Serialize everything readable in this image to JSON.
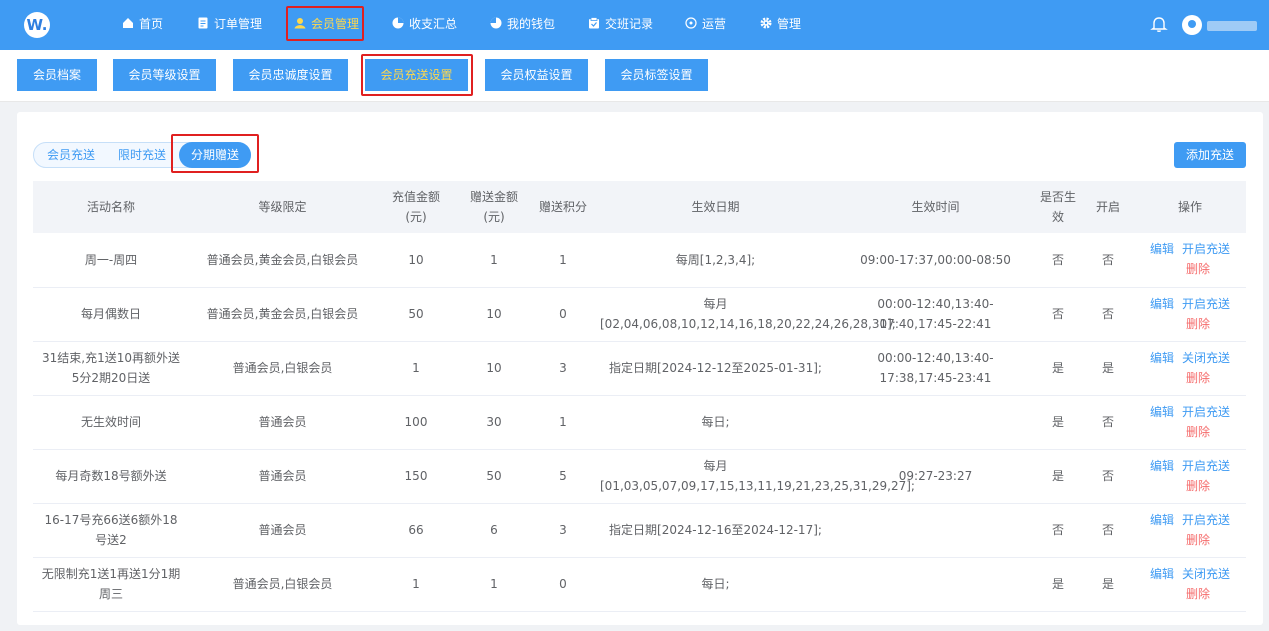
{
  "logo": "W.",
  "nav": [
    {
      "label": "首页",
      "icon": "home-icon"
    },
    {
      "label": "订单管理",
      "icon": "order-icon"
    },
    {
      "label": "会员管理",
      "icon": "member-icon"
    },
    {
      "label": "收支汇总",
      "icon": "pie-icon"
    },
    {
      "label": "我的钱包",
      "icon": "wallet-icon"
    },
    {
      "label": "交班记录",
      "icon": "shift-icon"
    },
    {
      "label": "运营",
      "icon": "compass-icon"
    },
    {
      "label": "管理",
      "icon": "gear-icon"
    }
  ],
  "subnav": [
    "会员档案",
    "会员等级设置",
    "会员忠诚度设置",
    "会员充送设置",
    "会员权益设置",
    "会员标签设置"
  ],
  "segments": [
    "会员充送",
    "限时充送",
    "分期赠送"
  ],
  "add_button": "添加充送",
  "table": {
    "headers": [
      "活动名称",
      "等级限定",
      "充值金额(元)",
      "赠送金额(元)",
      "赠送积分",
      "生效日期",
      "生效时间",
      "是否生效",
      "开启",
      "操作"
    ],
    "rows": [
      {
        "name": "周一-周四",
        "level": "普通会员,黄金会员,白银会员",
        "amount": "10",
        "gift": "1",
        "points": "1",
        "date": "每周[1,2,3,4];",
        "time": "09:00-17:37,00:00-08:50",
        "effective": "否",
        "open": "否",
        "edit": "编辑",
        "toggle": "开启充送",
        "del": "删除"
      },
      {
        "name": "每月偶数日",
        "level": "普通会员,黄金会员,白银会员",
        "amount": "50",
        "gift": "10",
        "points": "0",
        "date": "每月[02,04,06,08,10,12,14,16,18,20,22,24,26,28,30];",
        "time": "00:00-12:40,13:40-17:40,17:45-22:41",
        "effective": "否",
        "open": "否",
        "edit": "编辑",
        "toggle": "开启充送",
        "del": "删除"
      },
      {
        "name": "31结束,充1送10再额外送5分2期20日送",
        "level": "普通会员,白银会员",
        "amount": "1",
        "gift": "10",
        "points": "3",
        "date": "指定日期[2024-12-12至2025-01-31];",
        "time": "00:00-12:40,13:40-17:38,17:45-23:41",
        "effective": "是",
        "open": "是",
        "edit": "编辑",
        "toggle": "关闭充送",
        "del": "删除"
      },
      {
        "name": "无生效时间",
        "level": "普通会员",
        "amount": "100",
        "gift": "30",
        "points": "1",
        "date": "每日;",
        "time": "",
        "effective": "是",
        "open": "否",
        "edit": "编辑",
        "toggle": "开启充送",
        "del": "删除"
      },
      {
        "name": "每月奇数18号额外送",
        "level": "普通会员",
        "amount": "150",
        "gift": "50",
        "points": "5",
        "date": "每月[01,03,05,07,09,17,15,13,11,19,21,23,25,31,29,27];",
        "time": "09:27-23:27",
        "effective": "是",
        "open": "否",
        "edit": "编辑",
        "toggle": "开启充送",
        "del": "删除"
      },
      {
        "name": "16-17号充66送6额外18号送2",
        "level": "普通会员",
        "amount": "66",
        "gift": "6",
        "points": "3",
        "date": "指定日期[2024-12-16至2024-12-17];",
        "time": "",
        "effective": "否",
        "open": "否",
        "edit": "编辑",
        "toggle": "开启充送",
        "del": "删除"
      },
      {
        "name": "无限制充1送1再送1分1期周三",
        "level": "普通会员,白银会员",
        "amount": "1",
        "gift": "1",
        "points": "0",
        "date": "每日;",
        "time": "",
        "effective": "是",
        "open": "是",
        "edit": "编辑",
        "toggle": "关闭充送",
        "del": "删除"
      }
    ]
  }
}
